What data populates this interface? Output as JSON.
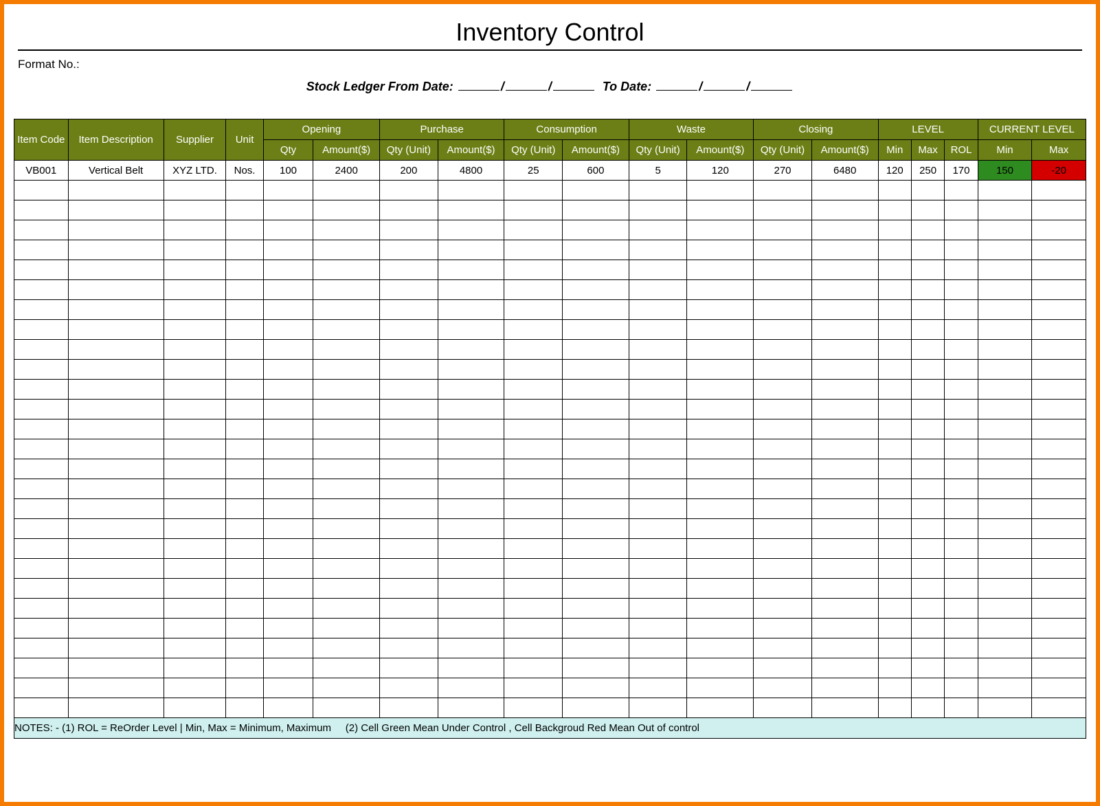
{
  "title": "Inventory Control",
  "format_label": "Format No.:",
  "ledger_from_label": "Stock Ledger From Date:",
  "to_label": "To Date:",
  "date_sep": "/",
  "headers": {
    "item_code": "Item Code",
    "item_desc": "Item Description",
    "supplier": "Supplier",
    "unit": "Unit",
    "groups": {
      "opening": "Opening",
      "purchase": "Purchase",
      "consumption": "Consumption",
      "waste": "Waste",
      "closing": "Closing",
      "level": "LEVEL",
      "current": "CURRENT LEVEL"
    },
    "sub": {
      "qty": "Qty",
      "amount": "Amount($)",
      "qty_unit": "Qty (Unit)",
      "min": "Min",
      "max": "Max",
      "rol": "ROL",
      "cur_min": "Min",
      "cur_max": "Max"
    }
  },
  "row": {
    "item_code": "VB001",
    "item_desc": "Vertical Belt",
    "supplier": "XYZ LTD.",
    "unit": "Nos.",
    "opening_qty": "100",
    "opening_amt": "2400",
    "purchase_qty": "200",
    "purchase_amt": "4800",
    "consumption_qty": "25",
    "consumption_amt": "600",
    "waste_qty": "5",
    "waste_amt": "120",
    "closing_qty": "270",
    "closing_amt": "6480",
    "level_min": "120",
    "level_max": "250",
    "level_rol": "170",
    "cur_min": "150",
    "cur_max": "-20"
  },
  "empty_rows": 27,
  "notes": "NOTES: - (1) ROL = ReOrder Level | Min, Max = Minimum, Maximum     (2) Cell Green Mean Under Control , Cell Backgroud Red Mean Out of control",
  "colors": {
    "frame": "#f57c00",
    "header": "#6b7f16",
    "green": "#2e8b1f",
    "red": "#d40000",
    "notes_bg": "#d0f0f0"
  }
}
